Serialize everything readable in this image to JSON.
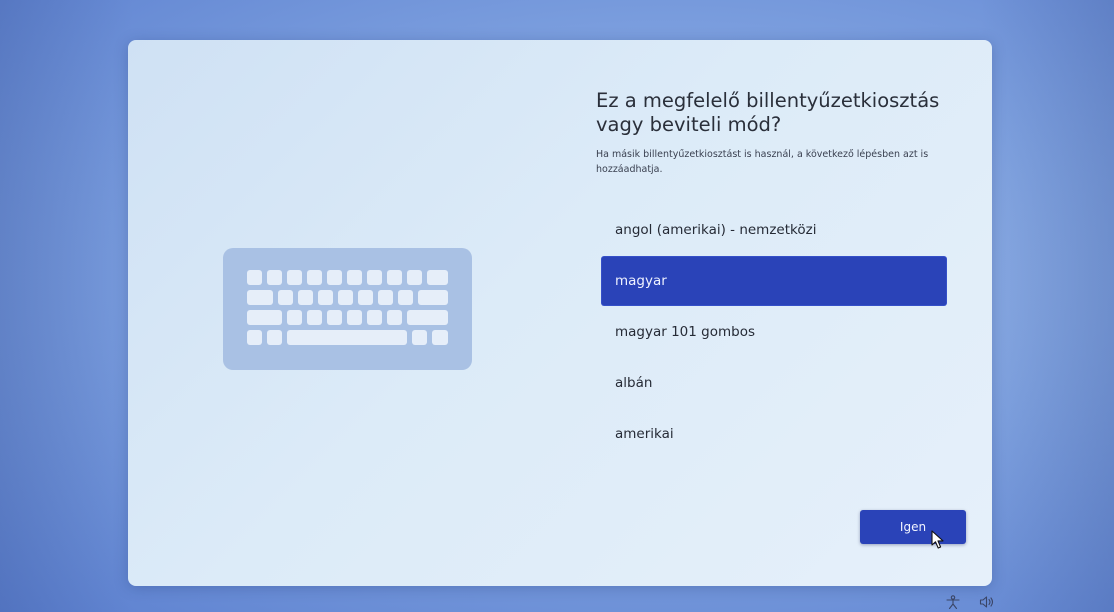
{
  "page": {
    "heading": "Ez a megfelelő billentyűzetkiosztás vagy beviteli mód?",
    "subtext": "Ha másik billentyűzetkiosztást is használ, a következő lépésben azt is hozzáadhatja."
  },
  "layouts": {
    "items": [
      {
        "label": "angol (amerikai) - nemzetközi",
        "selected": false
      },
      {
        "label": "magyar",
        "selected": true
      },
      {
        "label": "magyar 101 gombos",
        "selected": false
      },
      {
        "label": "albán",
        "selected": false
      },
      {
        "label": "amerikai",
        "selected": false
      }
    ]
  },
  "actions": {
    "confirm_label": "Igen"
  },
  "system_tray": {
    "icons": [
      "accessibility-icon",
      "volume-icon"
    ]
  },
  "colors": {
    "accent": "#2a43b8",
    "card": "#dcebf8",
    "desktop": "#7fa2e0"
  }
}
